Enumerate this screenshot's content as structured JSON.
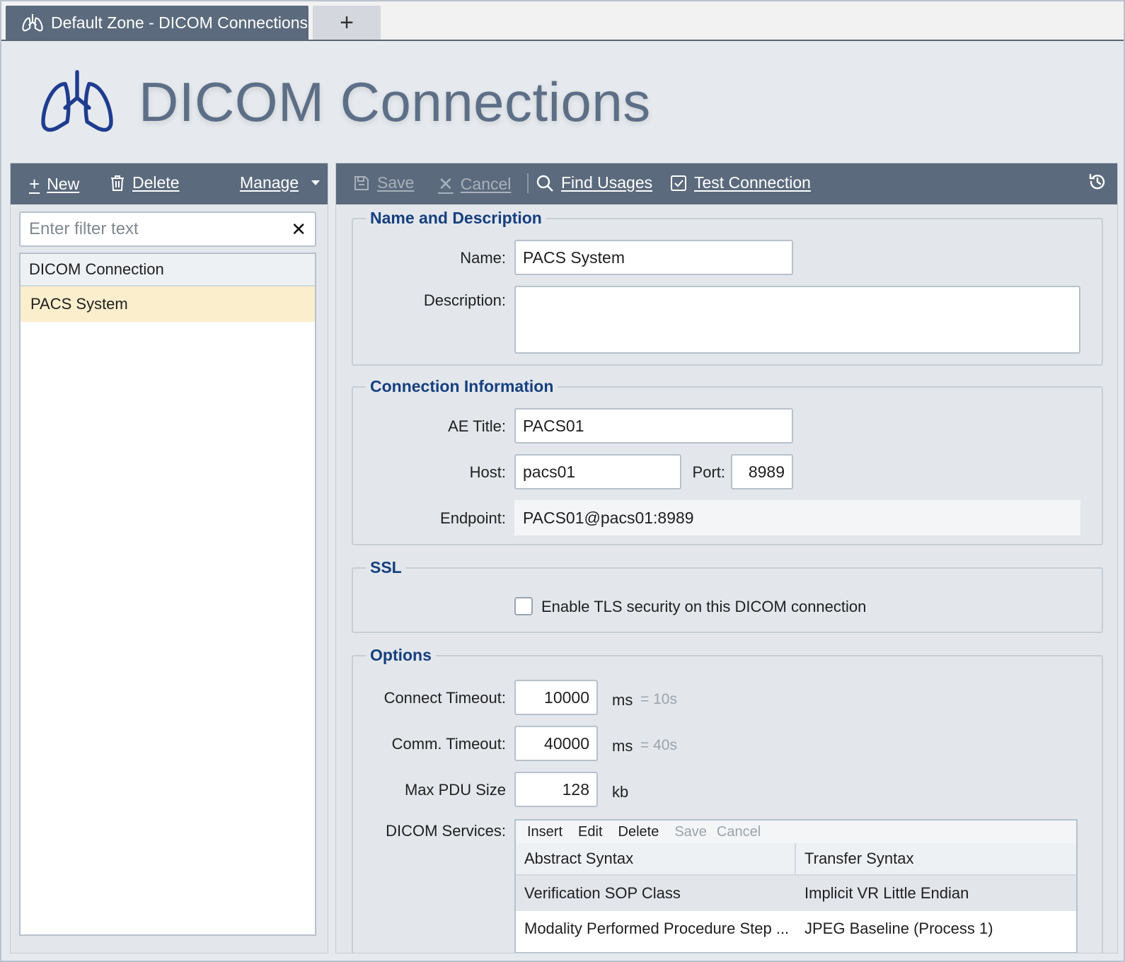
{
  "tab": {
    "title": "Default Zone - DICOM Connections",
    "icon": "lungs-icon",
    "add_label": "+"
  },
  "page": {
    "title": "DICOM Connections",
    "icon": "lungs-icon"
  },
  "left_toolbar": {
    "new_label": "New",
    "delete_label": "Delete",
    "manage_label": "Manage"
  },
  "filter": {
    "placeholder": "Enter filter text",
    "value": ""
  },
  "tree": {
    "header": "DICOM Connection",
    "items": [
      {
        "label": "PACS System",
        "selected": true
      }
    ]
  },
  "right_toolbar": {
    "save_label": "Save",
    "cancel_label": "Cancel",
    "find_usages_label": "Find Usages",
    "test_connection_label": "Test Connection"
  },
  "name_section": {
    "legend": "Name and Description",
    "name_label": "Name:",
    "name_value": "PACS System",
    "description_label": "Description:",
    "description_value": ""
  },
  "connection_section": {
    "legend": "Connection Information",
    "ae_title_label": "AE Title:",
    "ae_title_value": "PACS01",
    "host_label": "Host:",
    "host_value": "pacs01",
    "port_label": "Port:",
    "port_value": "8989",
    "endpoint_label": "Endpoint:",
    "endpoint_value": "PACS01@pacs01:8989"
  },
  "ssl_section": {
    "legend": "SSL",
    "tls_label": "Enable TLS security on this DICOM connection",
    "tls_checked": false
  },
  "options_section": {
    "legend": "Options",
    "connect_timeout_label": "Connect Timeout:",
    "connect_timeout_value": "10000",
    "connect_timeout_unit": "ms",
    "connect_timeout_hint": "= 10s",
    "comm_timeout_label": "Comm. Timeout:",
    "comm_timeout_value": "40000",
    "comm_timeout_unit": "ms",
    "comm_timeout_hint": "= 40s",
    "max_pdu_label": "Max PDU Size",
    "max_pdu_value": "128",
    "max_pdu_unit": "kb",
    "services_label": "DICOM Services:",
    "services_toolbar": {
      "insert": "Insert",
      "edit": "Edit",
      "delete": "Delete",
      "save": "Save",
      "cancel": "Cancel"
    },
    "services_columns": [
      "Abstract Syntax",
      "Transfer Syntax"
    ],
    "services_rows": [
      {
        "abstract": "Verification SOP Class",
        "transfer": "Implicit VR Little Endian"
      },
      {
        "abstract": "Modality Performed Procedure Step ...",
        "transfer": "JPEG Baseline (Process 1)"
      }
    ]
  },
  "colors": {
    "toolbar_bg": "#5b6a7c",
    "legend": "#163f7f",
    "selected_row": "#faeecd",
    "title": "#5d6f87"
  }
}
